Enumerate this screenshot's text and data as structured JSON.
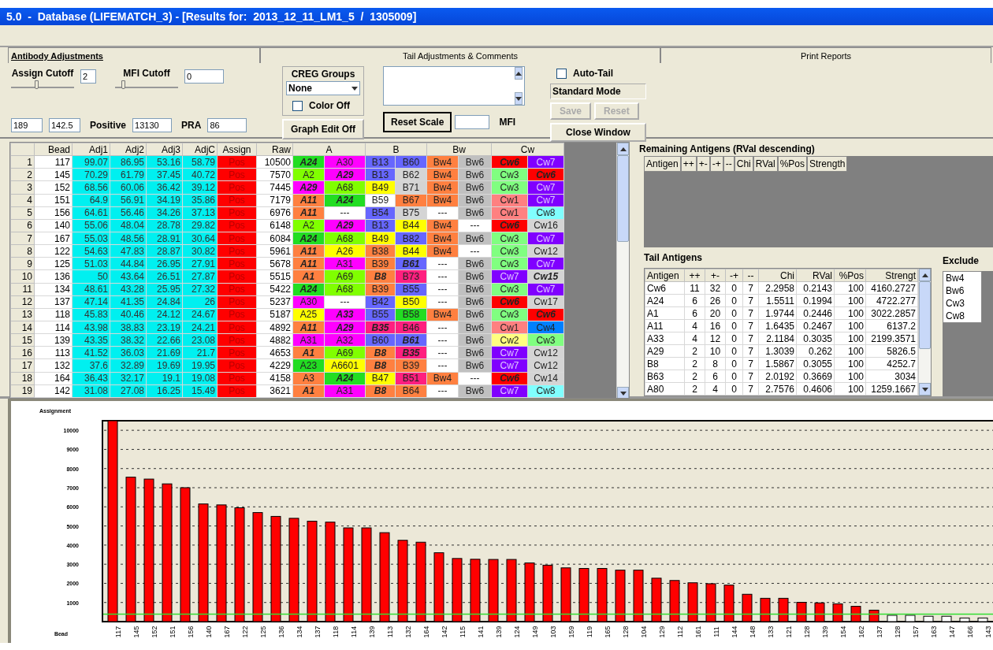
{
  "window": {
    "title": "5.0  -  Database (LIFEMATCH_3) - [Results for:  2013_12_11_LM1_5  /  1305009]"
  },
  "tabs": [
    {
      "label": "Antibody Adjustments",
      "selected": true
    },
    {
      "label": "Tail Adjustments & Comments",
      "selected": false
    },
    {
      "label": "Print Reports",
      "selected": false
    }
  ],
  "cutoffs": [
    {
      "label": "Assign Cutoff",
      "level": 0.4,
      "value": "2"
    },
    {
      "label": "MFI Cutoff",
      "level": 0.1,
      "value": "0"
    }
  ],
  "stats": [
    {
      "value": "189"
    },
    {
      "value": "142.5"
    },
    {
      "label": "Positive",
      "value": "13130"
    },
    {
      "label": "PRA",
      "value": "86"
    }
  ],
  "creg": {
    "title": "CREG Groups",
    "option": "None",
    "color_off": {
      "label": "Color Off",
      "checked": false
    }
  },
  "graph_edit_button": "Graph Edit Off",
  "reset_scale_button": "Reset Scale",
  "mfi_label": "MFI",
  "auto_tail": {
    "label": "Auto-Tail",
    "checked": false
  },
  "mode": "Standard Mode",
  "action_buttons": [
    {
      "label": "Save",
      "disabled": true
    },
    {
      "label": "Reset",
      "disabled": true
    }
  ],
  "close_button": "Close Window",
  "results": {
    "columns": [
      "Bead",
      "Adj1",
      "Adj2",
      "Adj3",
      "AdjC",
      "Assign",
      "Raw"
    ],
    "groups": [
      "A",
      "B",
      "Bw",
      "Cw"
    ],
    "rows": [
      {
        "num": "1",
        "bead": "117",
        "adj": [
          "99.07",
          "86.95",
          "53.16",
          "58.79"
        ],
        "assign": "Pos",
        "raw": "10500",
        "cells": [
          {
            "text": "A24",
            "color": "#22dd22",
            "bold": true
          },
          {
            "text": "A30",
            "color": "#ff00ff",
            "bold": false
          },
          {
            "text": "B13",
            "color": "#6666ff",
            "bold": false
          },
          {
            "text": "B60",
            "color": "#6666ff",
            "bold": false
          },
          {
            "text": "Bw4",
            "color": "#ff8040",
            "bold": false
          },
          {
            "text": "Bw6",
            "color": "#c0c0c0",
            "bold": false
          },
          {
            "text": "Cw6",
            "color": "#ff0000",
            "bold": true
          },
          {
            "text": "Cw7",
            "color": "#8000ff",
            "bold": false
          }
        ]
      },
      {
        "num": "2",
        "bead": "145",
        "adj": [
          "70.29",
          "61.79",
          "37.45",
          "40.72"
        ],
        "assign": "Pos",
        "raw": "7570",
        "cells": [
          {
            "text": "A2",
            "color": "#80ff00",
            "bold": false
          },
          {
            "text": "A29",
            "color": "#ff00ff",
            "bold": true
          },
          {
            "text": "B13",
            "color": "#6666ff",
            "bold": false
          },
          {
            "text": "B62",
            "color": "#d4d4d4",
            "bold": false
          },
          {
            "text": "Bw4",
            "color": "#ff8040",
            "bold": false
          },
          {
            "text": "Bw6",
            "color": "#c0c0c0",
            "bold": false
          },
          {
            "text": "Cw3",
            "color": "#80ff80",
            "bold": false
          },
          {
            "text": "Cw6",
            "color": "#ff0000",
            "bold": true
          }
        ]
      },
      {
        "num": "3",
        "bead": "152",
        "adj": [
          "68.56",
          "60.06",
          "36.42",
          "39.12"
        ],
        "assign": "Pos",
        "raw": "7445",
        "cells": [
          {
            "text": "A29",
            "color": "#ff00ff",
            "bold": true
          },
          {
            "text": "A68",
            "color": "#80ff00",
            "bold": false
          },
          {
            "text": "B49",
            "color": "#ffff00",
            "bold": false
          },
          {
            "text": "B71",
            "color": "#d4d4d4",
            "bold": false
          },
          {
            "text": "Bw4",
            "color": "#ff8040",
            "bold": false
          },
          {
            "text": "Bw6",
            "color": "#c0c0c0",
            "bold": false
          },
          {
            "text": "Cw3",
            "color": "#80ff80",
            "bold": false
          },
          {
            "text": "Cw7",
            "color": "#8000ff",
            "bold": false
          }
        ]
      },
      {
        "num": "4",
        "bead": "151",
        "adj": [
          "64.9",
          "56.91",
          "34.19",
          "35.86"
        ],
        "assign": "Pos",
        "raw": "7179",
        "cells": [
          {
            "text": "A11",
            "color": "#ff8040",
            "bold": true
          },
          {
            "text": "A24",
            "color": "#22dd22",
            "bold": true
          },
          {
            "text": "B59",
            "color": "#ffffff",
            "bold": false
          },
          {
            "text": "B67",
            "color": "#ff8040",
            "bold": false
          },
          {
            "text": "Bw4",
            "color": "#ff8040",
            "bold": false
          },
          {
            "text": "Bw6",
            "color": "#c0c0c0",
            "bold": false
          },
          {
            "text": "Cw1",
            "color": "#ff8080",
            "bold": false
          },
          {
            "text": "Cw7",
            "color": "#8000ff",
            "bold": false
          }
        ]
      },
      {
        "num": "5",
        "bead": "156",
        "adj": [
          "64.61",
          "56.46",
          "34.26",
          "37.13"
        ],
        "assign": "Pos",
        "raw": "6976",
        "cells": [
          {
            "text": "A11",
            "color": "#ff8040",
            "bold": true
          },
          {
            "text": "---",
            "color": "#ffffff",
            "bold": false
          },
          {
            "text": "B54",
            "color": "#6666ff",
            "bold": false
          },
          {
            "text": "B75",
            "color": "#d4d4d4",
            "bold": false
          },
          {
            "text": "---",
            "color": "#ffffff",
            "bold": false
          },
          {
            "text": "Bw6",
            "color": "#c0c0c0",
            "bold": false
          },
          {
            "text": "Cw1",
            "color": "#ff8080",
            "bold": false
          },
          {
            "text": "Cw8",
            "color": "#80ffff",
            "bold": false
          }
        ]
      },
      {
        "num": "6",
        "bead": "140",
        "adj": [
          "55.06",
          "48.04",
          "28.78",
          "29.82"
        ],
        "assign": "Pos",
        "raw": "6148",
        "cells": [
          {
            "text": "A2",
            "color": "#80ff00",
            "bold": false
          },
          {
            "text": "A29",
            "color": "#ff00ff",
            "bold": true
          },
          {
            "text": "B13",
            "color": "#6666ff",
            "bold": false
          },
          {
            "text": "B44",
            "color": "#ffff00",
            "bold": false
          },
          {
            "text": "Bw4",
            "color": "#ff8040",
            "bold": false
          },
          {
            "text": "---",
            "color": "#ffffff",
            "bold": false
          },
          {
            "text": "Cw6",
            "color": "#ff0000",
            "bold": true
          },
          {
            "text": "Cw16",
            "color": "#d4d4d4",
            "bold": false
          }
        ]
      },
      {
        "num": "7",
        "bead": "167",
        "adj": [
          "55.03",
          "48.56",
          "28.91",
          "30.64"
        ],
        "assign": "Pos",
        "raw": "6084",
        "cells": [
          {
            "text": "A24",
            "color": "#22dd22",
            "bold": true
          },
          {
            "text": "A68",
            "color": "#80ff00",
            "bold": false
          },
          {
            "text": "B49",
            "color": "#ffff00",
            "bold": false
          },
          {
            "text": "B82",
            "color": "#6666ff",
            "bold": false
          },
          {
            "text": "Bw4",
            "color": "#ff8040",
            "bold": false
          },
          {
            "text": "Bw6",
            "color": "#c0c0c0",
            "bold": false
          },
          {
            "text": "Cw3",
            "color": "#80ff80",
            "bold": false
          },
          {
            "text": "Cw7",
            "color": "#8000ff",
            "bold": false
          }
        ]
      },
      {
        "num": "8",
        "bead": "122",
        "adj": [
          "54.63",
          "47.83",
          "28.87",
          "30.82"
        ],
        "assign": "Pos",
        "raw": "5961",
        "cells": [
          {
            "text": "A11",
            "color": "#ff8040",
            "bold": true
          },
          {
            "text": "A26",
            "color": "#ffff00",
            "bold": false
          },
          {
            "text": "B38",
            "color": "#ff8040",
            "bold": false
          },
          {
            "text": "B44",
            "color": "#ffff00",
            "bold": false
          },
          {
            "text": "Bw4",
            "color": "#ff8040",
            "bold": false
          },
          {
            "text": "---",
            "color": "#ffffff",
            "bold": false
          },
          {
            "text": "Cw3",
            "color": "#80ff80",
            "bold": false
          },
          {
            "text": "Cw12",
            "color": "#d4d4d4",
            "bold": false
          }
        ]
      },
      {
        "num": "9",
        "bead": "125",
        "adj": [
          "51.03",
          "44.84",
          "26.95",
          "27.91"
        ],
        "assign": "Pos",
        "raw": "5678",
        "cells": [
          {
            "text": "A11",
            "color": "#ff8040",
            "bold": true
          },
          {
            "text": "A31",
            "color": "#ff00ff",
            "bold": false
          },
          {
            "text": "B39",
            "color": "#ff8040",
            "bold": false
          },
          {
            "text": "B61",
            "color": "#6666ff",
            "bold": true
          },
          {
            "text": "---",
            "color": "#ffffff",
            "bold": false
          },
          {
            "text": "Bw6",
            "color": "#c0c0c0",
            "bold": false
          },
          {
            "text": "Cw3",
            "color": "#80ff80",
            "bold": false
          },
          {
            "text": "Cw7",
            "color": "#8000ff",
            "bold": false
          }
        ]
      },
      {
        "num": "10",
        "bead": "136",
        "adj": [
          "50",
          "43.64",
          "26.51",
          "27.87"
        ],
        "assign": "Pos",
        "raw": "5515",
        "cells": [
          {
            "text": "A1",
            "color": "#ff8040",
            "bold": true
          },
          {
            "text": "A69",
            "color": "#80ff00",
            "bold": false
          },
          {
            "text": "B8",
            "color": "#ff8040",
            "bold": true
          },
          {
            "text": "B73",
            "color": "#ff1f7f",
            "bold": false
          },
          {
            "text": "---",
            "color": "#ffffff",
            "bold": false
          },
          {
            "text": "Bw6",
            "color": "#c0c0c0",
            "bold": false
          },
          {
            "text": "Cw7",
            "color": "#8000ff",
            "bold": false
          },
          {
            "text": "Cw15",
            "color": "#d4d4d4",
            "bold": true
          }
        ]
      },
      {
        "num": "11",
        "bead": "134",
        "adj": [
          "48.61",
          "43.28",
          "25.95",
          "27.32"
        ],
        "assign": "Pos",
        "raw": "5422",
        "cells": [
          {
            "text": "A24",
            "color": "#22dd22",
            "bold": true
          },
          {
            "text": "A68",
            "color": "#80ff00",
            "bold": false
          },
          {
            "text": "B39",
            "color": "#ff8040",
            "bold": false
          },
          {
            "text": "B55",
            "color": "#6666ff",
            "bold": false
          },
          {
            "text": "---",
            "color": "#ffffff",
            "bold": false
          },
          {
            "text": "Bw6",
            "color": "#c0c0c0",
            "bold": false
          },
          {
            "text": "Cw3",
            "color": "#80ff80",
            "bold": false
          },
          {
            "text": "Cw7",
            "color": "#8000ff",
            "bold": false
          }
        ]
      },
      {
        "num": "12",
        "bead": "137",
        "adj": [
          "47.14",
          "41.35",
          "24.84",
          "26"
        ],
        "assign": "Pos",
        "raw": "5237",
        "cells": [
          {
            "text": "A30",
            "color": "#ff00ff",
            "bold": false
          },
          {
            "text": "---",
            "color": "#ffffff",
            "bold": false
          },
          {
            "text": "B42",
            "color": "#6666ff",
            "bold": false
          },
          {
            "text": "B50",
            "color": "#ffff00",
            "bold": false
          },
          {
            "text": "---",
            "color": "#ffffff",
            "bold": false
          },
          {
            "text": "Bw6",
            "color": "#c0c0c0",
            "bold": false
          },
          {
            "text": "Cw6",
            "color": "#ff0000",
            "bold": true
          },
          {
            "text": "Cw17",
            "color": "#d4d4d4",
            "bold": false
          }
        ]
      },
      {
        "num": "13",
        "bead": "118",
        "adj": [
          "45.83",
          "40.46",
          "24.12",
          "24.67"
        ],
        "assign": "Pos",
        "raw": "5187",
        "cells": [
          {
            "text": "A25",
            "color": "#ffff00",
            "bold": false
          },
          {
            "text": "A33",
            "color": "#ff00ff",
            "bold": true
          },
          {
            "text": "B55",
            "color": "#6666ff",
            "bold": false
          },
          {
            "text": "B58",
            "color": "#22dd22",
            "bold": false
          },
          {
            "text": "Bw4",
            "color": "#ff8040",
            "bold": false
          },
          {
            "text": "Bw6",
            "color": "#c0c0c0",
            "bold": false
          },
          {
            "text": "Cw3",
            "color": "#80ff80",
            "bold": false
          },
          {
            "text": "Cw6",
            "color": "#ff0000",
            "bold": true
          }
        ]
      },
      {
        "num": "14",
        "bead": "114",
        "adj": [
          "43.98",
          "38.83",
          "23.19",
          "24.21"
        ],
        "assign": "Pos",
        "raw": "4892",
        "cells": [
          {
            "text": "A11",
            "color": "#ff8040",
            "bold": true
          },
          {
            "text": "A29",
            "color": "#ff00ff",
            "bold": true
          },
          {
            "text": "B35",
            "color": "#ff1f7f",
            "bold": true
          },
          {
            "text": "B46",
            "color": "#ff1f7f",
            "bold": false
          },
          {
            "text": "---",
            "color": "#ffffff",
            "bold": false
          },
          {
            "text": "Bw6",
            "color": "#c0c0c0",
            "bold": false
          },
          {
            "text": "Cw1",
            "color": "#ff8080",
            "bold": false
          },
          {
            "text": "Cw4",
            "color": "#0080ff",
            "bold": false
          }
        ]
      },
      {
        "num": "15",
        "bead": "139",
        "adj": [
          "43.35",
          "38.32",
          "22.66",
          "23.08"
        ],
        "assign": "Pos",
        "raw": "4882",
        "cells": [
          {
            "text": "A31",
            "color": "#ff00ff",
            "bold": false
          },
          {
            "text": "A32",
            "color": "#ff00ff",
            "bold": false
          },
          {
            "text": "B60",
            "color": "#6666ff",
            "bold": false
          },
          {
            "text": "B61",
            "color": "#6666ff",
            "bold": true
          },
          {
            "text": "---",
            "color": "#ffffff",
            "bold": false
          },
          {
            "text": "Bw6",
            "color": "#c0c0c0",
            "bold": false
          },
          {
            "text": "Cw2",
            "color": "#ffff80",
            "bold": false
          },
          {
            "text": "Cw3",
            "color": "#80ff80",
            "bold": false
          }
        ]
      },
      {
        "num": "16",
        "bead": "113",
        "adj": [
          "41.52",
          "36.03",
          "21.69",
          "21.7"
        ],
        "assign": "Pos",
        "raw": "4653",
        "cells": [
          {
            "text": "A1",
            "color": "#ff8040",
            "bold": true
          },
          {
            "text": "A69",
            "color": "#80ff00",
            "bold": false
          },
          {
            "text": "B8",
            "color": "#ff8040",
            "bold": true
          },
          {
            "text": "B35",
            "color": "#ff1f7f",
            "bold": true
          },
          {
            "text": "---",
            "color": "#ffffff",
            "bold": false
          },
          {
            "text": "Bw6",
            "color": "#c0c0c0",
            "bold": false
          },
          {
            "text": "Cw7",
            "color": "#8000ff",
            "bold": false
          },
          {
            "text": "Cw12",
            "color": "#d4d4d4",
            "bold": false
          }
        ]
      },
      {
        "num": "17",
        "bead": "132",
        "adj": [
          "37.6",
          "32.89",
          "19.69",
          "19.95"
        ],
        "assign": "Pos",
        "raw": "4229",
        "cells": [
          {
            "text": "A23",
            "color": "#22dd22",
            "bold": false
          },
          {
            "text": "A6601",
            "color": "#ffff00",
            "bold": false
          },
          {
            "text": "B8",
            "color": "#ff8040",
            "bold": true
          },
          {
            "text": "B39",
            "color": "#ff8040",
            "bold": false
          },
          {
            "text": "---",
            "color": "#ffffff",
            "bold": false
          },
          {
            "text": "Bw6",
            "color": "#c0c0c0",
            "bold": false
          },
          {
            "text": "Cw7",
            "color": "#8000ff",
            "bold": false
          },
          {
            "text": "Cw12",
            "color": "#d4d4d4",
            "bold": false
          }
        ]
      },
      {
        "num": "18",
        "bead": "164",
        "adj": [
          "36.43",
          "32.17",
          "19.1",
          "19.08"
        ],
        "assign": "Pos",
        "raw": "4158",
        "cells": [
          {
            "text": "A3",
            "color": "#ff8040",
            "bold": false
          },
          {
            "text": "A24",
            "color": "#22dd22",
            "bold": true
          },
          {
            "text": "B47",
            "color": "#ffff00",
            "bold": false
          },
          {
            "text": "B51",
            "color": "#ff1f7f",
            "bold": false
          },
          {
            "text": "Bw4",
            "color": "#ff8040",
            "bold": false
          },
          {
            "text": "---",
            "color": "#ffffff",
            "bold": false
          },
          {
            "text": "Cw6",
            "color": "#ff0000",
            "bold": true
          },
          {
            "text": "Cw14",
            "color": "#d4d4d4",
            "bold": false
          }
        ]
      },
      {
        "num": "19",
        "bead": "142",
        "adj": [
          "31.08",
          "27.08",
          "16.25",
          "15.49"
        ],
        "assign": "Pos",
        "raw": "3621",
        "cells": [
          {
            "text": "A1",
            "color": "#ff8040",
            "bold": true
          },
          {
            "text": "A31",
            "color": "#ff00ff",
            "bold": false
          },
          {
            "text": "B8",
            "color": "#ff8040",
            "bold": true
          },
          {
            "text": "B64",
            "color": "#ff8040",
            "bold": false
          },
          {
            "text": "---",
            "color": "#ffffff",
            "bold": false
          },
          {
            "text": "Bw6",
            "color": "#c0c0c0",
            "bold": false
          },
          {
            "text": "Cw7",
            "color": "#8000ff",
            "bold": false
          },
          {
            "text": "Cw8",
            "color": "#80ffff",
            "bold": false
          }
        ]
      }
    ]
  },
  "remaining": {
    "title": "Remaining Antigens (RVal descending)",
    "columns": [
      "Antigen",
      "++",
      "+-",
      "-+",
      "--",
      "Chi",
      "RVal",
      "%Pos",
      "Strength"
    ]
  },
  "tail": {
    "title": "Tail Antigens",
    "columns": [
      "Antigen",
      "++",
      "+-",
      "-+",
      "--",
      "Chi",
      "RVal",
      "%Pos",
      "Strengt"
    ],
    "rows": [
      [
        "Cw6",
        "11",
        "32",
        "0",
        "7",
        "2.2958",
        "0.2143",
        "100",
        "4160.2727"
      ],
      [
        "A24",
        "6",
        "26",
        "0",
        "7",
        "1.5511",
        "0.1994",
        "100",
        "4722.277"
      ],
      [
        "A1",
        "6",
        "20",
        "0",
        "7",
        "1.9744",
        "0.2446",
        "100",
        "3022.2857"
      ],
      [
        "A11",
        "4",
        "16",
        "0",
        "7",
        "1.6435",
        "0.2467",
        "100",
        "6137.2"
      ],
      [
        "A33",
        "4",
        "12",
        "0",
        "7",
        "2.1184",
        "0.3035",
        "100",
        "2199.3571"
      ],
      [
        "A29",
        "2",
        "10",
        "0",
        "7",
        "1.3039",
        "0.262",
        "100",
        "5826.5"
      ],
      [
        "B8",
        "2",
        "8",
        "0",
        "7",
        "1.5867",
        "0.3055",
        "100",
        "4252.7"
      ],
      [
        "B63",
        "2",
        "6",
        "0",
        "7",
        "2.0192",
        "0.3669",
        "100",
        "3034"
      ],
      [
        "A80",
        "2",
        "4",
        "0",
        "7",
        "2.7576",
        "0.4606",
        "100",
        "1259.1667"
      ]
    ]
  },
  "excluded": {
    "title": "Exclude",
    "items": [
      "Bw4",
      "Bw6",
      "Cw3",
      "Cw8"
    ]
  },
  "chart": {
    "chart_data": {
      "type": "bar",
      "ylabel": "Assignment",
      "xlabel": "Bead",
      "ylim": [
        0,
        10500
      ],
      "grid": true,
      "yticks": [
        1000,
        2000,
        3000,
        4000,
        5000,
        6000,
        7000,
        8000,
        9000,
        10000
      ],
      "categories": [
        "117",
        "145",
        "152",
        "151",
        "156",
        "140",
        "167",
        "122",
        "125",
        "136",
        "134",
        "137",
        "118",
        "114",
        "139",
        "113",
        "132",
        "164",
        "142",
        "115",
        "141",
        "139",
        "124",
        "149",
        "103",
        "159",
        "119",
        "165",
        "128",
        "104",
        "129",
        "112",
        "161",
        "111",
        "144",
        "148",
        "133",
        "121",
        "128",
        "139",
        "154",
        "162",
        "137",
        "128",
        "157",
        "163",
        "147",
        "166",
        "143"
      ],
      "series": [
        {
          "color": "#ff0000",
          "values": [
            10500,
            7550,
            7450,
            7200,
            7000,
            6150,
            6100,
            5950,
            5700,
            5500,
            5400,
            5250,
            5200,
            4900,
            4900,
            4650,
            4250,
            4150,
            3600,
            3300,
            3260,
            3250,
            3250,
            3070,
            2950,
            2810,
            2780,
            2780,
            2690,
            2690,
            2270,
            2150,
            2030,
            1980,
            1910,
            1430,
            1220,
            1220,
            1010,
            980,
            930,
            800,
            600,
            null,
            null,
            null,
            null,
            null,
            null
          ]
        },
        {
          "color": "#ffffff",
          "values": [
            null,
            null,
            null,
            null,
            null,
            null,
            null,
            null,
            null,
            null,
            null,
            null,
            null,
            null,
            null,
            null,
            null,
            null,
            null,
            null,
            null,
            null,
            null,
            null,
            null,
            null,
            null,
            null,
            null,
            null,
            null,
            null,
            null,
            null,
            null,
            null,
            null,
            null,
            null,
            null,
            null,
            null,
            null,
            330,
            330,
            280,
            280,
            190,
            190
          ]
        }
      ]
    }
  }
}
